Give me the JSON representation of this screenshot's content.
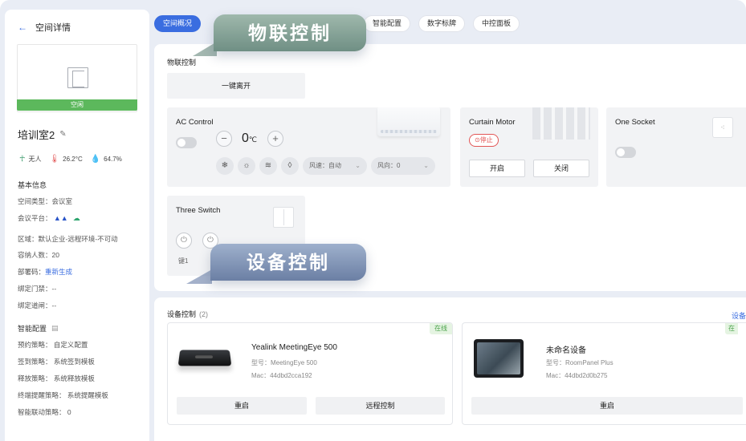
{
  "sidebar": {
    "back_label": "空间详情",
    "room_status": "空闲",
    "room_name": "培训室2",
    "occupancy": "无人",
    "temperature": "26.2°C",
    "humidity": "64.7%",
    "basic_title": "基本信息",
    "space_type": "空间类型：会议室",
    "platform_label": "会议平台：",
    "area": "区域：默认企业-远程环境-不可动",
    "capacity": "容纳人数：20",
    "deploy_label": "部署码：",
    "deploy_link": "重新生成",
    "door_access": "绑定门禁：--",
    "bind_channel": "绑定道闸：--",
    "smart_title": "智能配置",
    "booking_policy": "预约策略：  自定义配置",
    "checkin_policy": "签到策略：  系统签到模板",
    "release_policy": "释放策略：  系统释放模板",
    "reminder_policy": "终端提醒策略：  系统提醒模板",
    "linkage_policy": "智能联动策略：  0"
  },
  "tabs": [
    {
      "label": "空间概况",
      "active": true
    },
    {
      "label": "智能配置",
      "active": false
    },
    {
      "label": "数字标牌",
      "active": false
    },
    {
      "label": "中控面板",
      "active": false
    }
  ],
  "banners": {
    "iot": "物联控制",
    "devices": "设备控制"
  },
  "iot": {
    "title": "物联控制",
    "one_key_leave": "一键离开",
    "ac": {
      "name": "AC Control",
      "temp_value": "0",
      "temp_unit": "℃",
      "minus": "−",
      "plus": "+",
      "fan_speed": "风速：自动",
      "wind_direction": "风向：0",
      "modes": [
        "snowflake-icon",
        "sun-icon",
        "wind-icon",
        "droplet-icon"
      ]
    },
    "curtain": {
      "name": "Curtain Motor",
      "stop_badge": "停止",
      "open_label": "开启",
      "close_label": "关闭"
    },
    "socket": {
      "name": "One Socket"
    },
    "switch": {
      "name": "Three Switch",
      "key1": "键1"
    }
  },
  "devices": {
    "title": "设备控制",
    "count": "(2)",
    "edge_link": "设备",
    "items": [
      {
        "status": "在线",
        "name": "Yealink MeetingEye 500",
        "model": "型号：MeetingEye 500",
        "mac": "Mac：44dbd2cca192",
        "restart": "重启",
        "remote": "远程控制"
      },
      {
        "status": "在",
        "name": "未命名设备",
        "model": "型号：RoomPanel Plus",
        "mac": "Mac：44dbd2d0b275",
        "restart": "重启"
      }
    ]
  },
  "colors": {
    "accent": "#3a6de0",
    "status_green": "#5cb85c",
    "stop_red": "#e25555",
    "temperature_red": "#e25555"
  }
}
